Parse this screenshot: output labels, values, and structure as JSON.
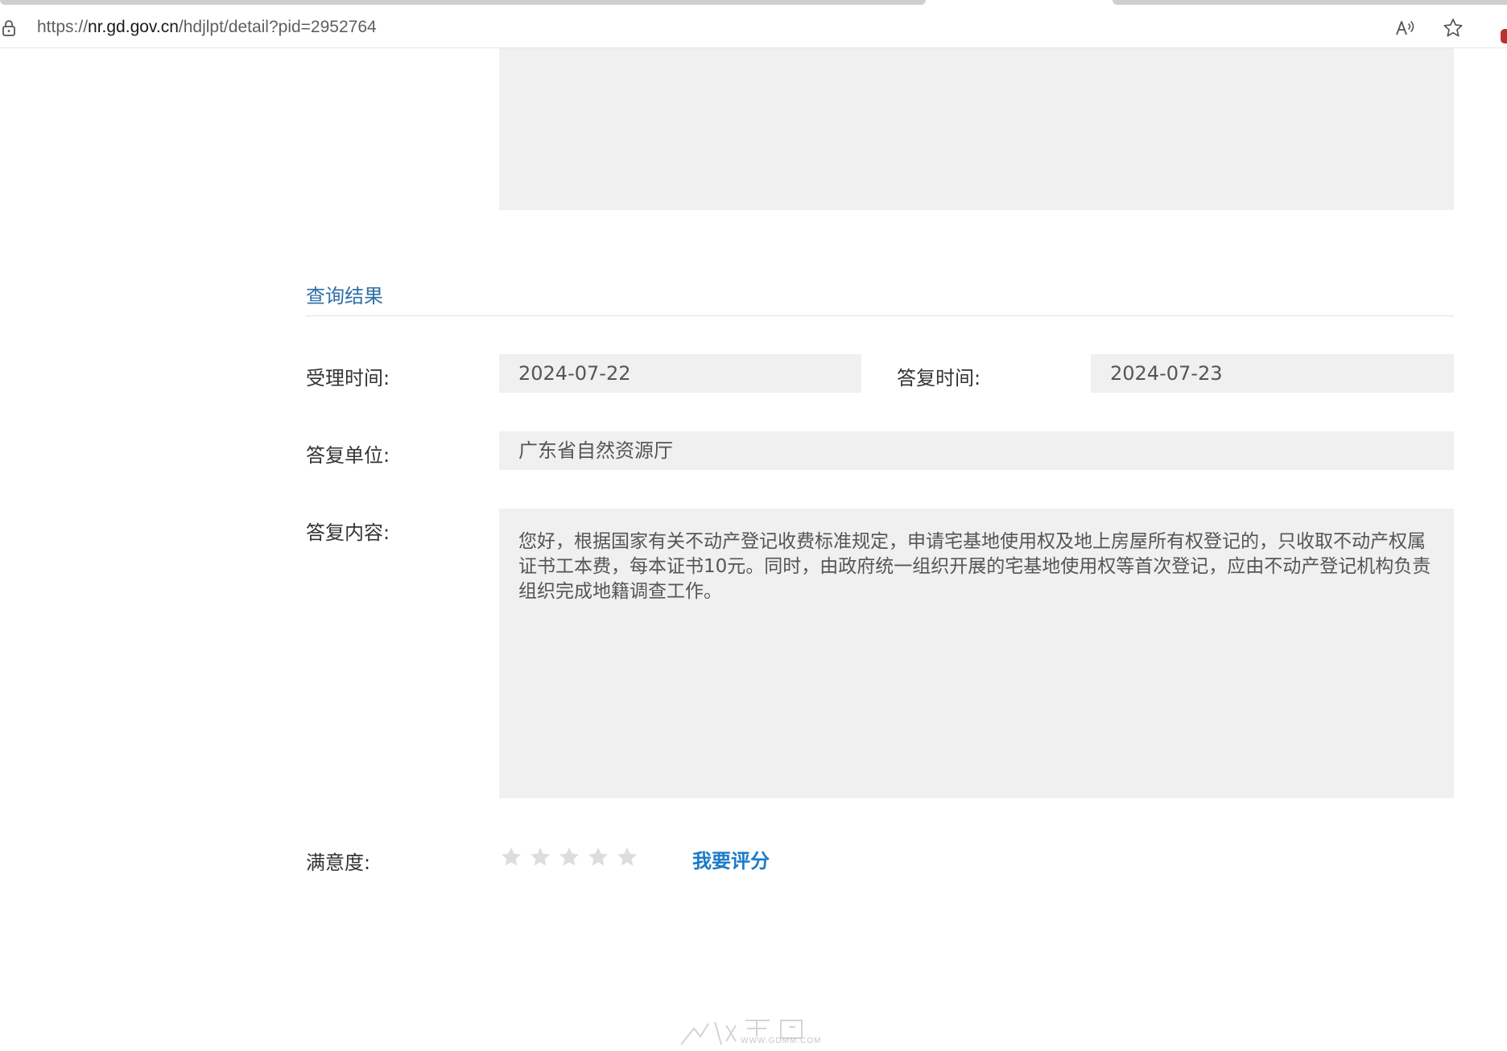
{
  "browser": {
    "url_prefix": "https://",
    "url_host": "nr.gd.gov.cn",
    "url_path": "/hdjlpt/detail?pid=2952764",
    "icons": [
      "lock-icon",
      "read-aloud-icon",
      "favorite-star-icon"
    ]
  },
  "result": {
    "section_title": "查询结果",
    "accept_time_label": "受理时间:",
    "accept_time_value": "2024-07-22",
    "reply_time_label": "答复时间:",
    "reply_time_value": "2024-07-23",
    "reply_unit_label": "答复单位:",
    "reply_unit_value": "广东省自然资源厅",
    "reply_content_label": "答复内容:",
    "reply_content_value": "您好，根据国家有关不动产登记收费标准规定，申请宅基地使用权及地上房屋所有权登记的，只收取不动产权属证书工本费，每本证书10元。同时，由政府统一组织开展的宅基地使用权等首次登记，应由不动产登记机构负责组织完成地籍调查工作。"
  },
  "rating": {
    "label": "满意度:",
    "stars_filled": 0,
    "stars_total": 5,
    "rate_link": "我要评分"
  },
  "watermark": {
    "text": "WWW.GDMM.COM"
  },
  "colors": {
    "field_bg": "#f0f0f0",
    "section_title": "#2e6fa6",
    "link": "#1a7bc9",
    "star_empty": "#dddddd"
  }
}
